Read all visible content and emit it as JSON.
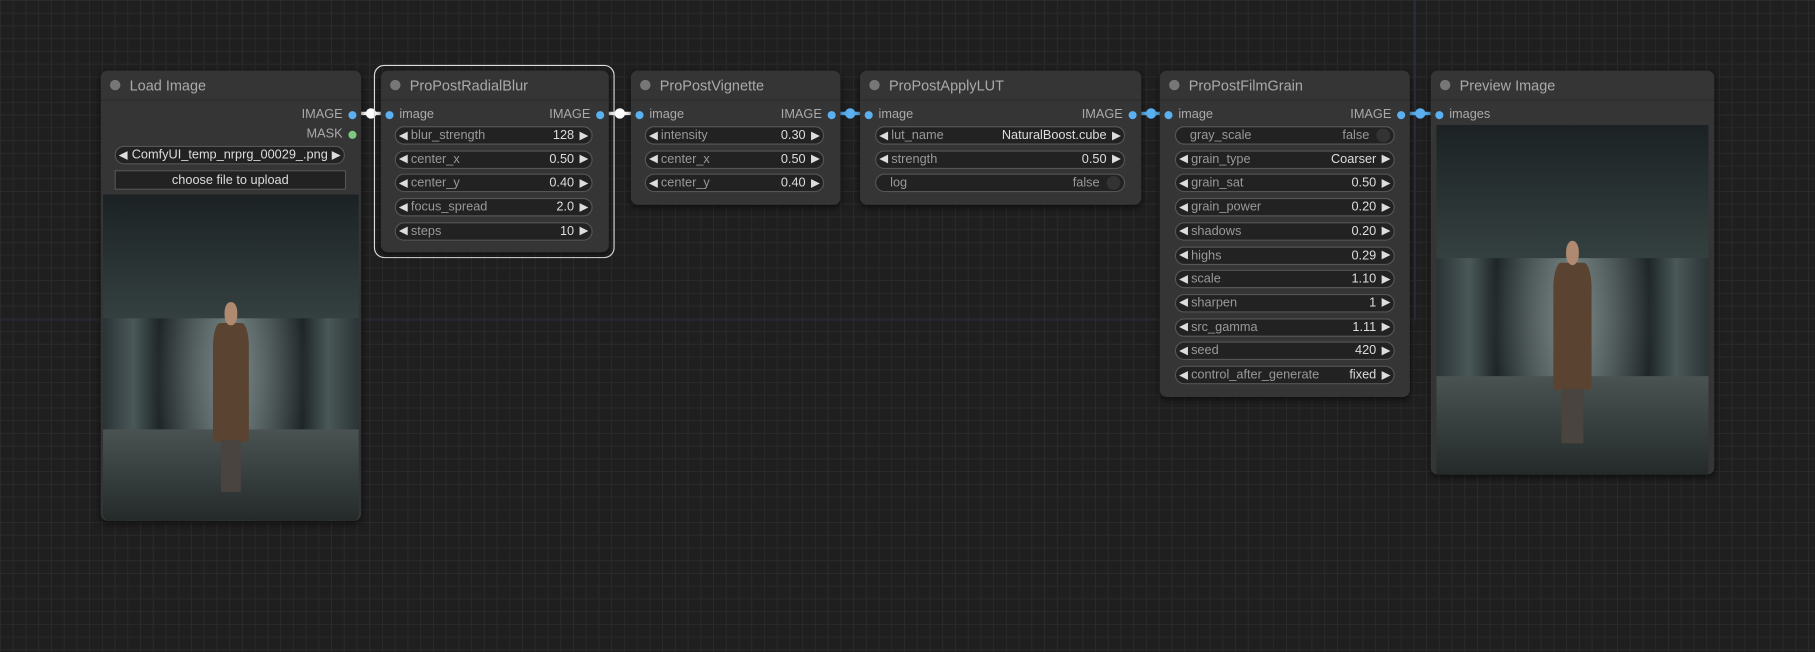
{
  "colors": {
    "link_selected": "#ffffff",
    "link_image": "#5ab0f0",
    "mask_slot": "#7fc97f",
    "background": "#1f1f1f",
    "node": "#353535"
  },
  "nodes": {
    "load_image": {
      "title": "Load Image",
      "outputs": [
        "IMAGE",
        "MASK"
      ],
      "image_combo": "ComfyUI_temp_nrprg_00029_.png",
      "upload_label": "choose file to upload"
    },
    "radial_blur": {
      "title": "ProPostRadialBlur",
      "input": "image",
      "output": "IMAGE",
      "widgets": [
        {
          "label": "blur_strength",
          "value": "128"
        },
        {
          "label": "center_x",
          "value": "0.50"
        },
        {
          "label": "center_y",
          "value": "0.40"
        },
        {
          "label": "focus_spread",
          "value": "2.0"
        },
        {
          "label": "steps",
          "value": "10"
        }
      ]
    },
    "vignette": {
      "title": "ProPostVignette",
      "input": "image",
      "output": "IMAGE",
      "widgets": [
        {
          "label": "intensity",
          "value": "0.30"
        },
        {
          "label": "center_x",
          "value": "0.50"
        },
        {
          "label": "center_y",
          "value": "0.40"
        }
      ]
    },
    "apply_lut": {
      "title": "ProPostApplyLUT",
      "input": "image",
      "output": "IMAGE",
      "widgets": [
        {
          "label": "lut_name",
          "value": "NaturalBoost.cube"
        },
        {
          "label": "strength",
          "value": "0.50"
        },
        {
          "label": "log",
          "value": "false",
          "toggle": true
        }
      ]
    },
    "film_grain": {
      "title": "ProPostFilmGrain",
      "input": "image",
      "output": "IMAGE",
      "widgets": [
        {
          "label": "gray_scale",
          "value": "false",
          "toggle": true
        },
        {
          "label": "grain_type",
          "value": "Coarser"
        },
        {
          "label": "grain_sat",
          "value": "0.50"
        },
        {
          "label": "grain_power",
          "value": "0.20"
        },
        {
          "label": "shadows",
          "value": "0.20"
        },
        {
          "label": "highs",
          "value": "0.29"
        },
        {
          "label": "scale",
          "value": "1.10"
        },
        {
          "label": "sharpen",
          "value": "1"
        },
        {
          "label": "src_gamma",
          "value": "1.11"
        },
        {
          "label": "seed",
          "value": "420"
        },
        {
          "label": "control_after_generate",
          "value": "fixed"
        }
      ]
    },
    "preview": {
      "title": "Preview Image",
      "input": "images"
    }
  }
}
